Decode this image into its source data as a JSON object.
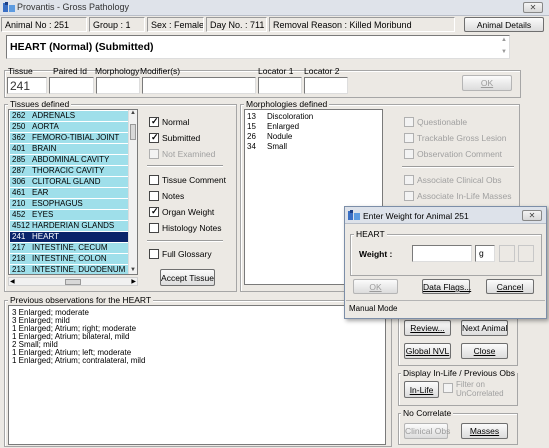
{
  "window": {
    "title": "Provantis - Gross Pathology",
    "close_label": "✕"
  },
  "info": {
    "animal_no": "Animal No : 251",
    "group": "Group : 1",
    "sex": "Sex : Female",
    "day_no": "Day No. : 711",
    "removal_reason": "Removal Reason : Killed Moribund",
    "animal_details_button": "Animal Details"
  },
  "header_text": "HEART (Normal)  (Submitted)",
  "entry": {
    "tissue_label": "Tissue",
    "paired_id_label": "Paired Id",
    "morphology_label": "Morphology",
    "modifiers_label": "Modifier(s)",
    "locator1_label": "Locator 1",
    "locator2_label": "Locator 2",
    "tissue_value": "241",
    "ok_button": "OK"
  },
  "tissues": {
    "group_label": "Tissues defined",
    "items": [
      {
        "code": "262",
        "name": "ADRENALS"
      },
      {
        "code": "250",
        "name": "AORTA"
      },
      {
        "code": "362",
        "name": "FEMORO-TIBIAL JOINT"
      },
      {
        "code": "401",
        "name": "BRAIN"
      },
      {
        "code": "285",
        "name": "ABDOMINAL CAVITY"
      },
      {
        "code": "287",
        "name": "THORACIC CAVITY"
      },
      {
        "code": "306",
        "name": "CLITORAL GLAND"
      },
      {
        "code": "461",
        "name": "EAR"
      },
      {
        "code": "210",
        "name": "ESOPHAGUS"
      },
      {
        "code": "452",
        "name": "EYES"
      },
      {
        "code": "4512",
        "name": "HARDERIAN GLANDS"
      },
      {
        "code": "241",
        "name": "HEART"
      },
      {
        "code": "217",
        "name": "INTESTINE, CECUM"
      },
      {
        "code": "218",
        "name": "INTESTINE, COLON"
      },
      {
        "code": "213",
        "name": "INTESTINE, DUODENUM"
      }
    ],
    "selected_index": 11
  },
  "options": {
    "normal": "Normal",
    "submitted": "Submitted",
    "not_examined": "Not Examined",
    "tissue_comment": "Tissue Comment",
    "notes": "Notes",
    "organ_weight": "Organ Weight",
    "histology_notes": "Histology Notes",
    "full_glossary": "Full Glossary",
    "accept_tissue": "Accept Tissue"
  },
  "morphologies": {
    "group_label": "Morphologies defined",
    "items": [
      {
        "code": "13",
        "name": "Discoloration"
      },
      {
        "code": "15",
        "name": "Enlarged"
      },
      {
        "code": "26",
        "name": "Nodule"
      },
      {
        "code": "34",
        "name": "Small"
      }
    ]
  },
  "flags": {
    "questionable": "Questionable",
    "trackable_gross_lesion": "Trackable Gross Lesion",
    "observation_comment": "Observation Comment",
    "associate_clinical_obs": "Associate Clinical Obs",
    "associate_inlife_masses": "Associate In-Life Masses"
  },
  "previous": {
    "group_label": "Previous observations for the HEART",
    "lines": [
      "3 Enlarged; moderate",
      "3 Enlarged; mild",
      "1 Enlarged; Atrium; right; moderate",
      "1 Enlarged; Atrium; bilateral, mild",
      "2 Small; mild",
      "1 Enlarged; Atrium; left; moderate",
      "1 Enlarged; Atrium; contralateral, mild"
    ]
  },
  "actions": {
    "review": "Review...",
    "next_animal": "Next Animal",
    "global_nvl": "Global NVL",
    "close": "Close"
  },
  "display_group": {
    "label": "Display In-Life / Previous Obs",
    "inlife_button": "In-Life",
    "filter_label": "Filter on UnCorrelated"
  },
  "no_correlate": {
    "label": "No Correlate",
    "clinical_obs": "Clinical Obs",
    "masses": "Masses"
  },
  "dialog": {
    "title": "Enter Weight for Animal 251",
    "group_label": "HEART",
    "weight_label": "Weight :",
    "unit": "g",
    "ok": "OK",
    "data_flags": "Data Flags...",
    "cancel": "Cancel",
    "status": "Manual Mode"
  }
}
